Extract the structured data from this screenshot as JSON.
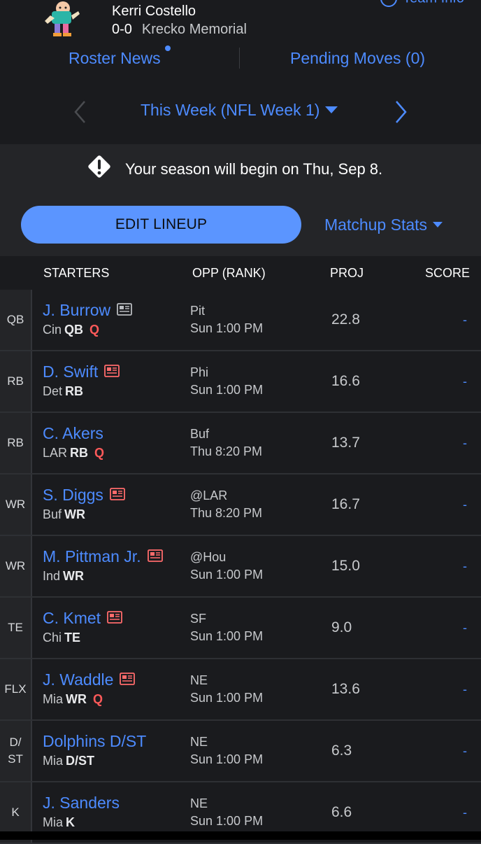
{
  "header": {
    "owner_name": "Kerri Costello",
    "record": "0-0",
    "league_name": "Krecko Memorial",
    "team_info_label": "Team Info",
    "roster_news_label": "Roster News",
    "pending_moves_label": "Pending Moves (0)"
  },
  "week": {
    "label": "This Week (NFL Week 1)"
  },
  "notice": {
    "text": "Your season will begin on Thu, Sep 8."
  },
  "actions": {
    "edit_lineup_label": "EDIT LINEUP",
    "matchup_stats_label": "Matchup Stats"
  },
  "table": {
    "headers": {
      "starters": "STARTERS",
      "opp": "OPP (RANK)",
      "proj": "PROJ",
      "score": "SCORE"
    },
    "rows": [
      {
        "slot": "QB",
        "name": "J. Burrow",
        "news": "gray",
        "team": "Cin",
        "pos": "QB",
        "status": "Q",
        "opp": "Pit",
        "time": "Sun 1:00 PM",
        "proj": "22.8",
        "score": "-"
      },
      {
        "slot": "RB",
        "name": "D. Swift",
        "news": "red",
        "team": "Det",
        "pos": "RB",
        "status": "",
        "opp": "Phi",
        "time": "Sun 1:00 PM",
        "proj": "16.6",
        "score": "-"
      },
      {
        "slot": "RB",
        "name": "C. Akers",
        "news": "",
        "team": "LAR",
        "pos": "RB",
        "status": "Q",
        "opp": "Buf",
        "time": "Thu 8:20 PM",
        "proj": "13.7",
        "score": "-"
      },
      {
        "slot": "WR",
        "name": "S. Diggs",
        "news": "red",
        "team": "Buf",
        "pos": "WR",
        "status": "",
        "opp": "@LAR",
        "time": "Thu 8:20 PM",
        "proj": "16.7",
        "score": "-"
      },
      {
        "slot": "WR",
        "name": "M. Pittman Jr.",
        "news": "red",
        "team": "Ind",
        "pos": "WR",
        "status": "",
        "opp": "@Hou",
        "time": "Sun 1:00 PM",
        "proj": "15.0",
        "score": "-"
      },
      {
        "slot": "TE",
        "name": "C. Kmet",
        "news": "red",
        "team": "Chi",
        "pos": "TE",
        "status": "",
        "opp": "SF",
        "time": "Sun 1:00 PM",
        "proj": "9.0",
        "score": "-"
      },
      {
        "slot": "FLX",
        "name": "J. Waddle",
        "news": "red",
        "team": "Mia",
        "pos": "WR",
        "status": "Q",
        "opp": "NE",
        "time": "Sun 1:00 PM",
        "proj": "13.6",
        "score": "-"
      },
      {
        "slot": "D/\nST",
        "name": "Dolphins D/ST",
        "news": "",
        "team": "Mia",
        "pos": "D/ST",
        "status": "",
        "opp": "NE",
        "time": "Sun 1:00 PM",
        "proj": "6.3",
        "score": "-"
      },
      {
        "slot": "K",
        "name": "J. Sanders",
        "news": "",
        "team": "Mia",
        "pos": "K",
        "status": "",
        "opp": "NE",
        "time": "Sun 1:00 PM",
        "proj": "6.6",
        "score": "-"
      }
    ]
  },
  "colors": {
    "accent": "#4d8bff",
    "button": "#5b95ff",
    "injury": "#ff5a5a",
    "news_gray": "#b8bbbf",
    "news_red": "#ff6b6b"
  }
}
